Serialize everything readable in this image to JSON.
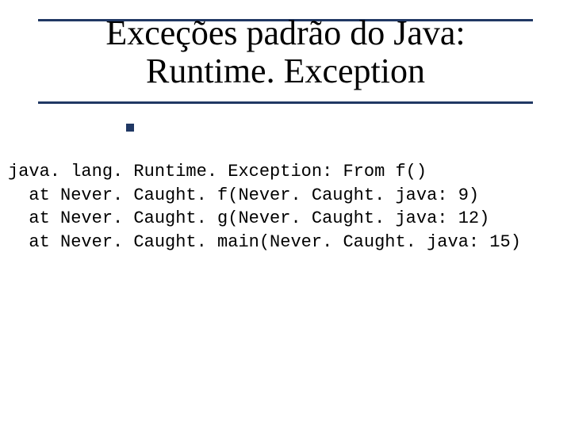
{
  "title": {
    "line1": "Exceções padrão do Java:",
    "line2": "Runtime. Exception"
  },
  "trace": {
    "line1": "java. lang. Runtime. Exception: From f()",
    "line2": "  at Never. Caught. f(Never. Caught. java: 9)",
    "line3": "  at Never. Caught. g(Never. Caught. java: 12)",
    "line4": "  at Never. Caught. main(Never. Caught. java: 15)"
  }
}
